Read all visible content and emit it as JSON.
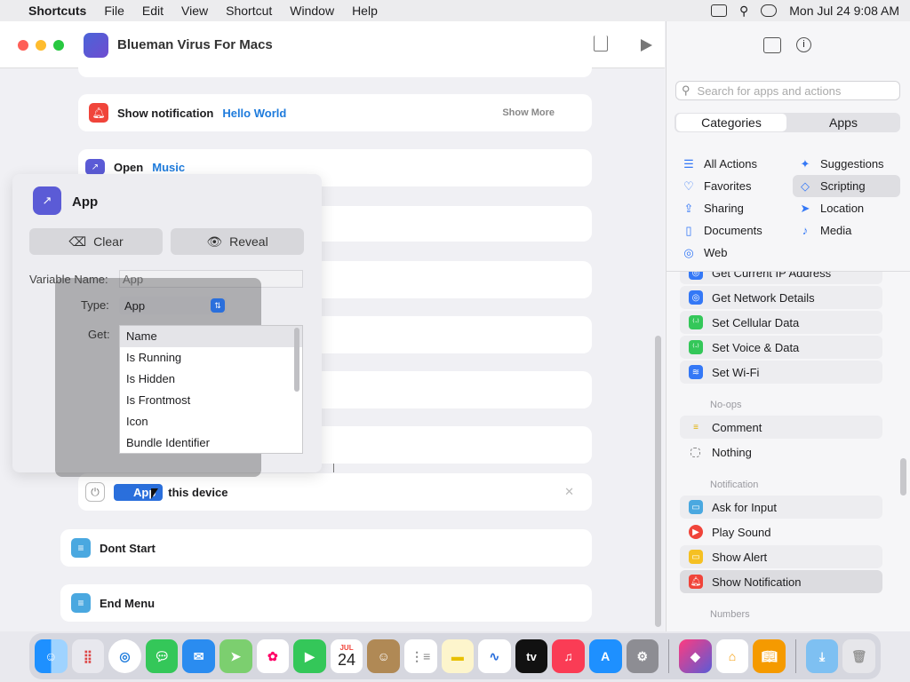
{
  "menubar": {
    "app": "Shortcuts",
    "items": [
      "File",
      "Edit",
      "View",
      "Shortcut",
      "Window",
      "Help"
    ],
    "clock": "Mon Jul 24  9:08 AM"
  },
  "window": {
    "title": "Blueman Virus For Macs"
  },
  "editor": {
    "notification_label": "Show notification",
    "notification_value": "Hello World",
    "show_more": "Show More",
    "open_label": "Open",
    "open_app": "Music",
    "app_chip": "App",
    "this_device": "this device",
    "dont_start": "Dont Start",
    "end_menu": "End Menu"
  },
  "popover": {
    "title": "App",
    "clear": "Clear",
    "reveal": "Reveal",
    "variable_name_label": "Variable Name:",
    "variable_name_placeholder": "App",
    "type_label": "Type:",
    "type_value": "App",
    "get_label": "Get:",
    "get_items": [
      "Name",
      "Is Running",
      "Is Hidden",
      "Is Frontmost",
      "Icon",
      "Bundle Identifier"
    ]
  },
  "sidebar": {
    "search_placeholder": "Search for apps and actions",
    "tab_categories": "Categories",
    "tab_apps": "Apps",
    "cats_left": [
      "All Actions",
      "Favorites",
      "Sharing",
      "Documents",
      "Web"
    ],
    "cats_right": [
      "Suggestions",
      "Scripting",
      "Location",
      "Media"
    ],
    "actions": [
      "Get Current IP Address",
      "Get Network Details",
      "Set Cellular Data",
      "Set Voice & Data",
      "Set Wi-Fi"
    ],
    "section_noops": "No-ops",
    "noops": [
      "Comment",
      "Nothing"
    ],
    "section_notification": "Notification",
    "notification_actions": [
      "Ask for Input",
      "Play Sound",
      "Show Alert",
      "Show Notification"
    ],
    "section_numbers": "Numbers"
  },
  "dock": {
    "calendar_month": "JUL",
    "calendar_day": "24",
    "tv_label": "tv"
  },
  "colors": {
    "accent": "#3478f6",
    "notification_red": "#f0443a",
    "chip_blue": "#1e7bdc"
  }
}
